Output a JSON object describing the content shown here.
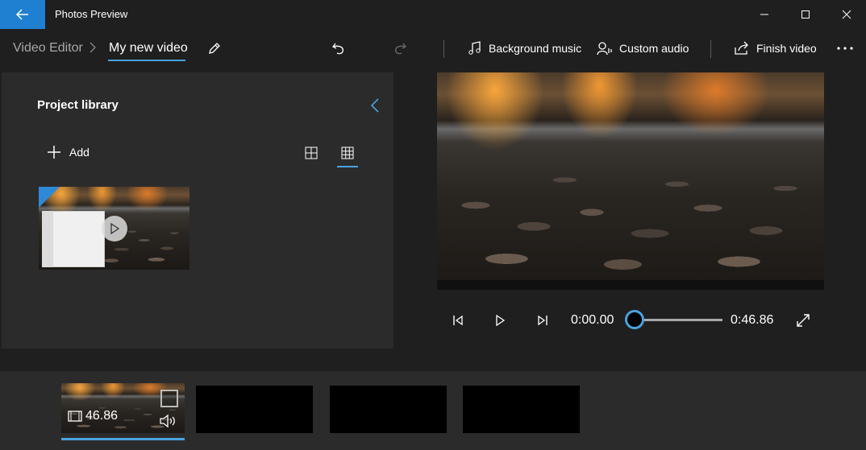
{
  "app": {
    "title": "Photos Preview"
  },
  "breadcrumb": {
    "parent": "Video Editor",
    "current": "My new video"
  },
  "toolbar": {
    "background_music": "Background music",
    "custom_audio": "Custom audio",
    "finish_video": "Finish video"
  },
  "library": {
    "title": "Project library",
    "add_label": "Add",
    "selected_view": "grid-small"
  },
  "playback": {
    "current_time": "0:00.00",
    "total_time": "0:46.86",
    "progress": 0
  },
  "storyboard": {
    "clips": [
      {
        "duration": "46.86"
      }
    ],
    "empty_slots": 3
  },
  "colors": {
    "accent": "#1f7fd1",
    "underline": "#4aa3df",
    "panel": "#2b2b2b",
    "background": "#1f1f1f"
  }
}
